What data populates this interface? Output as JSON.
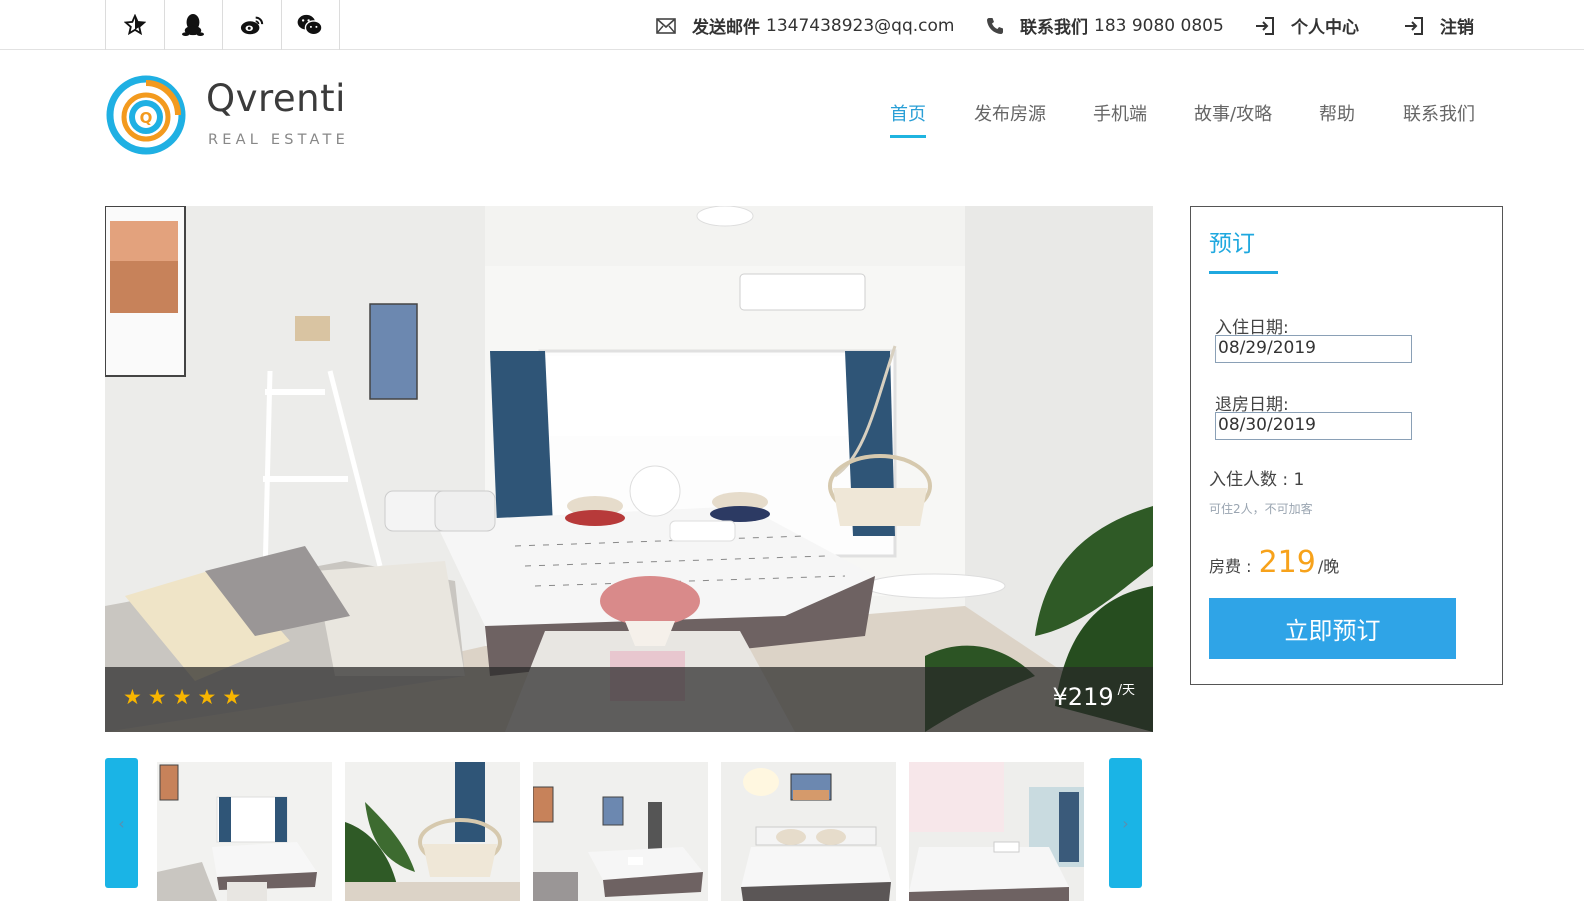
{
  "topbar": {
    "social": [
      "star-icon",
      "qq-icon",
      "weibo-icon",
      "wechat-icon"
    ],
    "email_label": "发送邮件",
    "email_value": "1347438923@qq.com",
    "phone_label": "联系我们",
    "phone_value": "183 9080 0805",
    "user_center": "个人中心",
    "logout": "注销"
  },
  "logo": {
    "brand": "Qvrenti",
    "tagline": "REAL ESTATE",
    "mark": "Q"
  },
  "nav": {
    "items": [
      "首页",
      "发布房源",
      "手机端",
      "故事/攻略",
      "帮助",
      "联系我们"
    ],
    "active": "首页"
  },
  "listing": {
    "rating_stars": 5,
    "price_symbol": "¥",
    "price": "219",
    "price_unit": "/天"
  },
  "booking": {
    "title": "预订",
    "checkin_label": "入住日期:",
    "checkin_value": "08/29/2019",
    "checkout_label": "退房日期:",
    "checkout_value": "08/30/2019",
    "guests_label": "入住人数 : ",
    "guests_value": "1",
    "guests_note": "可住2人，不可加客",
    "fee_label": "房费 : ",
    "fee_value": "219",
    "fee_unit": "/晚",
    "book_button": "立即预订"
  },
  "gallery": {
    "prev_icon": "chevron-left-icon",
    "next_icon": "chevron-right-icon",
    "thumb_count": 5
  },
  "colors": {
    "accent": "#1fa8df",
    "button": "#2fa4e7",
    "price": "#f7a21b",
    "star": "#f7b500"
  }
}
